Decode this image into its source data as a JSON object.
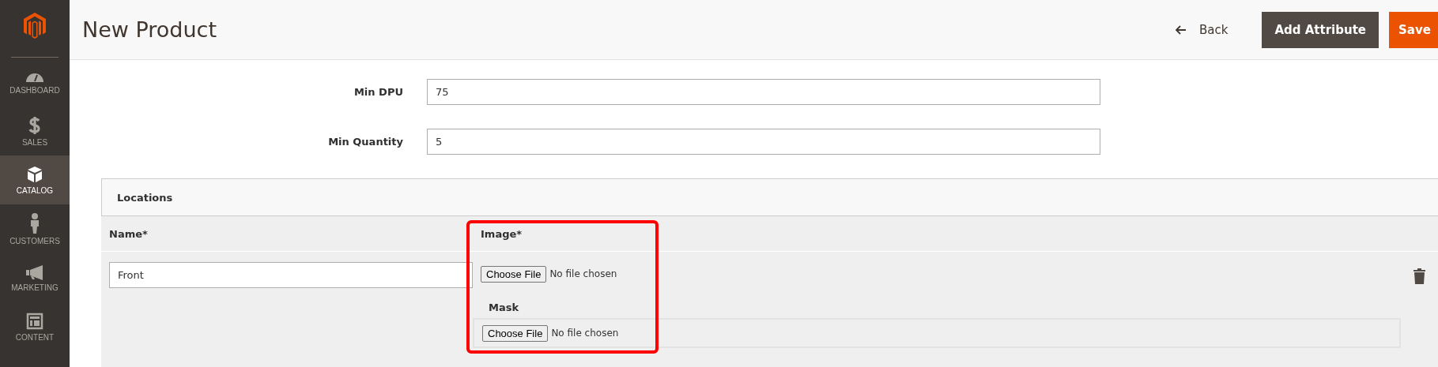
{
  "sidebar": {
    "items": [
      {
        "kind": "dashboard",
        "label": "DASHBOARD",
        "selected": false
      },
      {
        "kind": "sales",
        "label": "SALES",
        "selected": false
      },
      {
        "kind": "catalog",
        "label": "CATALOG",
        "selected": true
      },
      {
        "kind": "customers",
        "label": "CUSTOMERS",
        "selected": false
      },
      {
        "kind": "marketing",
        "label": "MARKETING",
        "selected": false
      },
      {
        "kind": "content",
        "label": "CONTENT",
        "selected": false
      }
    ]
  },
  "header": {
    "title": "New Product",
    "back": "Back",
    "buttons": [
      {
        "kind": "secondary",
        "label": "Add Attribute"
      },
      {
        "kind": "primary",
        "label": "Save"
      }
    ]
  },
  "fields": [
    {
      "label": "Min DPU",
      "value": "75"
    },
    {
      "label": "Min Quantity",
      "value": "5"
    }
  ],
  "locations": {
    "title": "Locations",
    "columns": [
      "Name*",
      "Image*"
    ],
    "rows": [
      {
        "name": "Front",
        "image": {
          "button": "Choose File",
          "status": "No file chosen"
        },
        "mask": {
          "label": "Mask",
          "button": "Choose File",
          "status": "No file chosen"
        }
      }
    ]
  }
}
